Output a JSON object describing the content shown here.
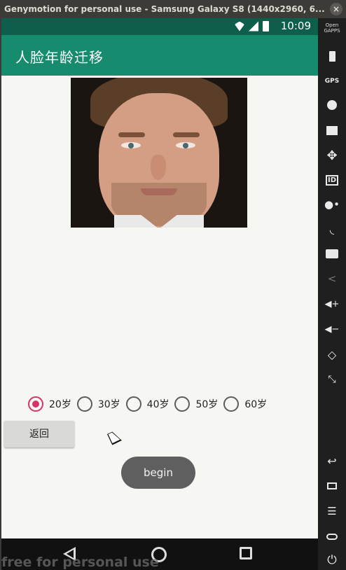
{
  "window": {
    "title": "Genymotion for personal use - Samsung Galaxy S8 (1440x2960, 6...",
    "close_glyph": "×"
  },
  "statusbar": {
    "time": "10:09"
  },
  "appbar": {
    "title": "人脸年龄迁移"
  },
  "age_options": {
    "selected": "20岁",
    "items": [
      {
        "label": "20岁",
        "checked": true
      },
      {
        "label": "30岁",
        "checked": false
      },
      {
        "label": "40岁",
        "checked": false
      },
      {
        "label": "50岁",
        "checked": false
      },
      {
        "label": "60岁",
        "checked": false
      }
    ]
  },
  "buttons": {
    "back_label": "返回",
    "begin_label": "begin"
  },
  "watermark": "free for personal use",
  "sidebar": {
    "opengapps_label": "Open GAPPS",
    "gps_label": "GPS",
    "id_label": "ID",
    "icons": [
      "opengapps-icon",
      "battery-icon",
      "gps-icon",
      "camera-icon",
      "capture-icon",
      "dpad-icon",
      "id-icon",
      "identifiers-icon",
      "cast-icon",
      "sms-icon",
      "share-icon",
      "volume-up-icon",
      "volume-down-icon",
      "rotate-icon",
      "scale-icon",
      "back-icon",
      "recents-icon",
      "menu-icon",
      "home-icon",
      "power-icon"
    ]
  },
  "colors": {
    "statusbar": "#0e5e4c",
    "appbar": "#168b6e",
    "radio_accent": "#d6336c",
    "begin_button": "#5f5f5f",
    "screen_background": "#f6f6f3"
  }
}
